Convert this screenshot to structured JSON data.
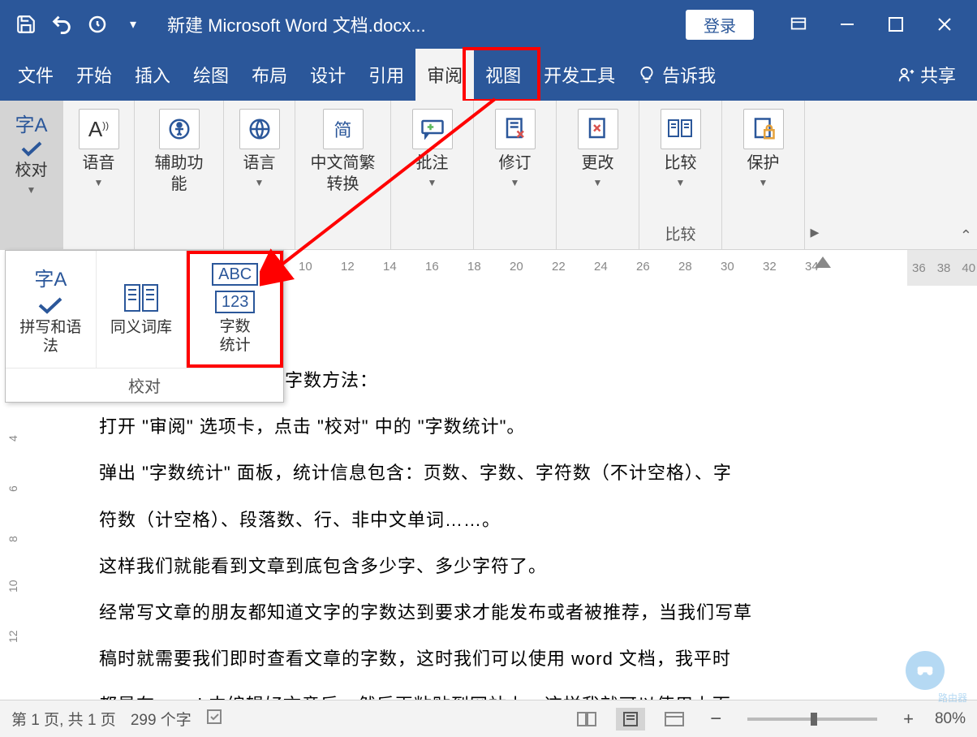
{
  "titlebar": {
    "title": "新建 Microsoft Word 文档.docx...",
    "login": "登录"
  },
  "menu": {
    "file": "文件",
    "home": "开始",
    "insert": "插入",
    "draw": "绘图",
    "layout": "布局",
    "design": "设计",
    "references": "引用",
    "review": "审阅",
    "view": "视图",
    "developer": "开发工具",
    "tellme": "告诉我",
    "share": "共享"
  },
  "ribbon": {
    "proofing": "校对",
    "speech": "语音",
    "accessibility": "辅助功\n能",
    "language": "语言",
    "chinese_conv": "中文简繁\n转换",
    "comments": "批注",
    "tracking": "修订",
    "changes": "更改",
    "compare": "比较",
    "compare_sub": "比较",
    "protect": "保护"
  },
  "popup": {
    "spellgrammar": "拼写和语法",
    "thesaurus": "同义词库",
    "wordcount_l1": "字数",
    "wordcount_l2": "统计",
    "abc": "ABC",
    "n123": "123",
    "footer": "校对"
  },
  "ruler": [
    "10",
    "12",
    "14",
    "16",
    "18",
    "20",
    "22",
    "24",
    "26",
    "28",
    "30",
    "32",
    "34",
    "36",
    "38",
    "40"
  ],
  "vruler": [
    "4",
    "6",
    "8",
    "10",
    "12"
  ],
  "doc": {
    "l1": "看字数方法：",
    "l2": "打开 \"审阅\" 选项卡，点击 \"校对\" 中的 \"字数统计\"。",
    "l3": "弹出 \"字数统计\" 面板，统计信息包含：页数、字数、字符数（不计空格）、字",
    "l4": "符数（计空格）、段落数、行、非中文单词……。",
    "l5": "这样我们就能看到文章到底包含多少字、多少字符了。",
    "l6": "经常写文章的朋友都知道文字的字数达到要求才能发布或者被推荐，当我们写草",
    "l7": "稿时就需要我们即时查看文章的字数，这时我们可以使用 word 文档，我平时",
    "l8": "都是在 word 中编辑好文章后，然后再粘贴到网站上，这样我就可以使用上面"
  },
  "status": {
    "page": "第 1 页, 共 1 页",
    "words": "299 个字",
    "zoom": "80%"
  },
  "watermark": "路由器"
}
